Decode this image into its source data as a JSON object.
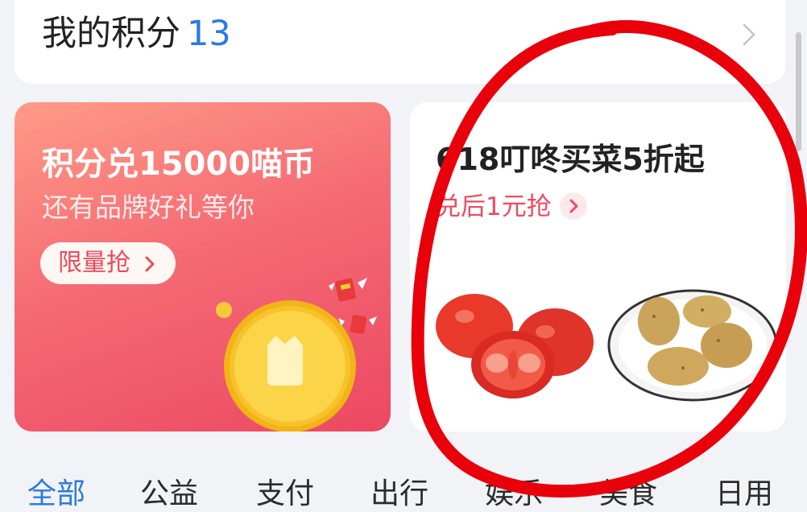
{
  "points": {
    "label": "我的积分",
    "value": "13"
  },
  "promo_left": {
    "title": "积分兑15000喵币",
    "subtitle": "还有品牌好礼等你",
    "button_label": "限量抢"
  },
  "promo_right": {
    "title": "618叮咚买菜5折起",
    "subtitle": "兑后1元抢"
  },
  "tabs": [
    {
      "label": "全部",
      "active": true
    },
    {
      "label": "公益",
      "active": false
    },
    {
      "label": "支付",
      "active": false
    },
    {
      "label": "出行",
      "active": false
    },
    {
      "label": "娱乐",
      "active": false
    },
    {
      "label": "美食",
      "active": false
    },
    {
      "label": "日用",
      "active": false
    }
  ],
  "colors": {
    "accent_blue": "#2a7ae2",
    "promo_pink": "#ef4a62",
    "annotation_red": "#e8000b"
  },
  "icons": [
    "chevron-right-icon",
    "coin-icon",
    "red-envelope-icon",
    "tomato-image",
    "potato-image"
  ]
}
